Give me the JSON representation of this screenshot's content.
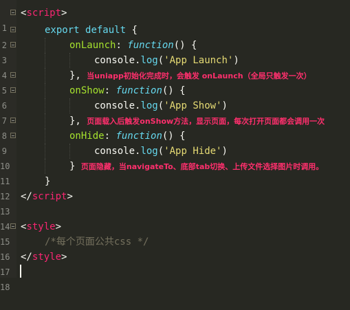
{
  "lines": [
    {
      "n": "1",
      "fold": true
    },
    {
      "n": "2",
      "fold": true
    },
    {
      "n": "3",
      "fold": true
    },
    {
      "n": "4",
      "fold": false
    },
    {
      "n": "5",
      "fold": true
    },
    {
      "n": "6",
      "fold": true
    },
    {
      "n": "7",
      "fold": false
    },
    {
      "n": "8",
      "fold": true
    },
    {
      "n": "9",
      "fold": true
    },
    {
      "n": "10",
      "fold": false
    },
    {
      "n": "11",
      "fold": false
    },
    {
      "n": "12",
      "fold": false
    },
    {
      "n": "13",
      "fold": false
    },
    {
      "n": "14",
      "fold": false
    },
    {
      "n": "15",
      "fold": true
    },
    {
      "n": "16",
      "fold": false
    },
    {
      "n": "17",
      "fold": false
    },
    {
      "n": "18",
      "fold": false
    }
  ],
  "code": {
    "l1_open": "<",
    "l1_tag": "script",
    "l1_close": ">",
    "l2_kw1": "export",
    "l2_kw2": "default",
    "l2_brace": "{",
    "l3_name": "onLaunch",
    "l3_colon": ": ",
    "l3_func": "function",
    "l3_rest": "() {",
    "l4_obj": "console",
    "l4_dot": ".",
    "l4_method": "log",
    "l4_paren_open": "(",
    "l4_str": "'App Launch'",
    "l4_paren_close": ")",
    "l5_close": "},",
    "l6_name": "onShow",
    "l6_colon": ": ",
    "l6_func": "function",
    "l6_rest": "() {",
    "l7_obj": "console",
    "l7_dot": ".",
    "l7_method": "log",
    "l7_paren_open": "(",
    "l7_str": "'App Show'",
    "l7_paren_close": ")",
    "l8_close": "},",
    "l9_name": "onHide",
    "l9_colon": ": ",
    "l9_func": "function",
    "l9_rest": "() {",
    "l10_obj": "console",
    "l10_dot": ".",
    "l10_method": "log",
    "l10_paren_open": "(",
    "l10_str": "'App Hide'",
    "l10_paren_close": ")",
    "l11_close": "}",
    "l12_close": "}",
    "l13_open": "</",
    "l13_tag": "script",
    "l13_close": ">",
    "l15_open": "<",
    "l15_tag": "style",
    "l15_close": ">",
    "l16_comment": "/*每个页面公共css */",
    "l17_open": "</",
    "l17_tag": "style",
    "l17_close": ">"
  },
  "annotations": {
    "launch": "当uniapp初始化完成时，会触发 onLaunch（全局只触发一次）",
    "show": "页面载入后触发onShow方法，显示页面，每次打开页面都会调用一次",
    "hide": "页面隐藏，当navigateTo、底部tab切换、上传文件选择图片时调用。"
  },
  "colors": {
    "background": "#272822",
    "keyword": "#66d9ef",
    "tag": "#f92672",
    "function_name": "#a6e22e",
    "string": "#e6db74",
    "comment": "#75715e",
    "annotation": "#ff2f6d"
  }
}
